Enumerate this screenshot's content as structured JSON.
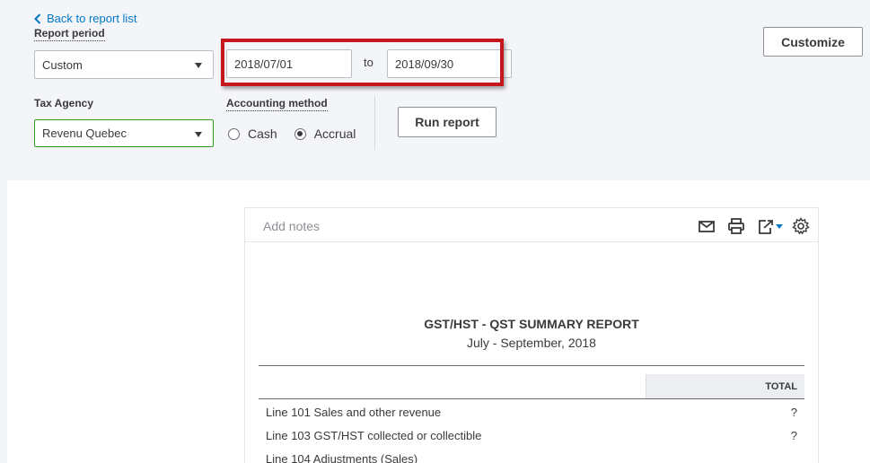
{
  "header": {
    "back_link": "Back to report list",
    "report_period_label": "Report period",
    "report_period_value": "Custom",
    "date_from": "2018/07/01",
    "to_label": "to",
    "date_to": "2018/09/30",
    "tax_agency_label": "Tax Agency",
    "tax_agency_value": "Revenu Quebec",
    "accounting_method_label": "Accounting method",
    "method_cash": "Cash",
    "method_accrual": "Accrual",
    "selected_method": "Accrual",
    "run_report": "Run report",
    "customize": "Customize"
  },
  "report": {
    "add_notes": "Add notes",
    "toolbar_icons": [
      "email-icon",
      "print-icon",
      "export-icon",
      "settings-icon"
    ],
    "title": "GST/HST - QST SUMMARY REPORT",
    "subtitle": "July - September, 2018",
    "total_header": "TOTAL",
    "rows": [
      {
        "label": "Line 101 Sales and other revenue",
        "value": "?"
      },
      {
        "label": "Line 103 GST/HST collected or collectible",
        "value": "?"
      },
      {
        "label": "Line 104 Adjustments (Sales)",
        "value": ""
      }
    ]
  },
  "colors": {
    "highlight": "#c4161c",
    "link": "#0077c5",
    "accent_green": "#2ca01c"
  }
}
